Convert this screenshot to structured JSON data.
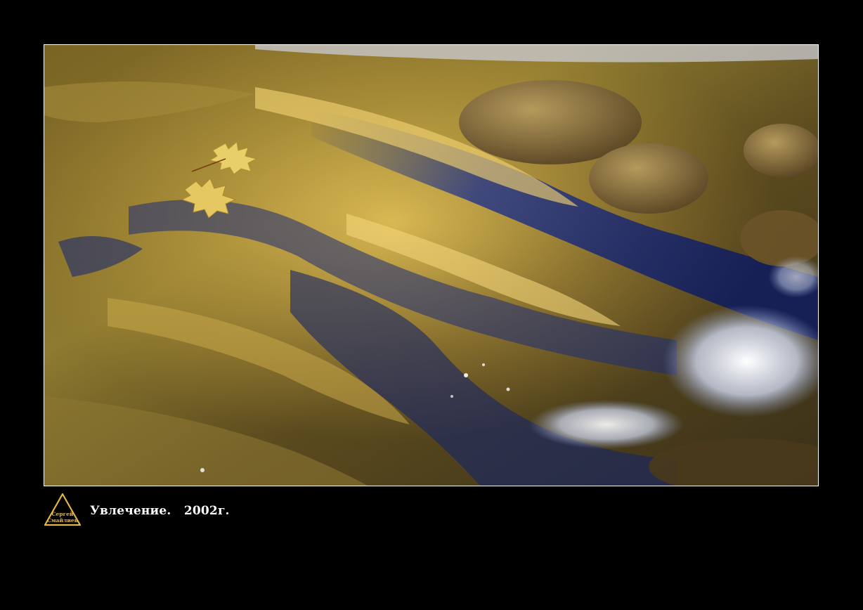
{
  "photo": {
    "subject": "stream-water-over-rocks-with-maple-leaves"
  },
  "logo": {
    "line1": "Сергей",
    "line2": "Смайлиев",
    "color": "#e0b64a"
  },
  "caption": {
    "title": "Увлечение.",
    "year": "2002г."
  },
  "colors": {
    "background": "#000000",
    "frame_border": "#ffffff",
    "caption_text": "#ffffff"
  }
}
